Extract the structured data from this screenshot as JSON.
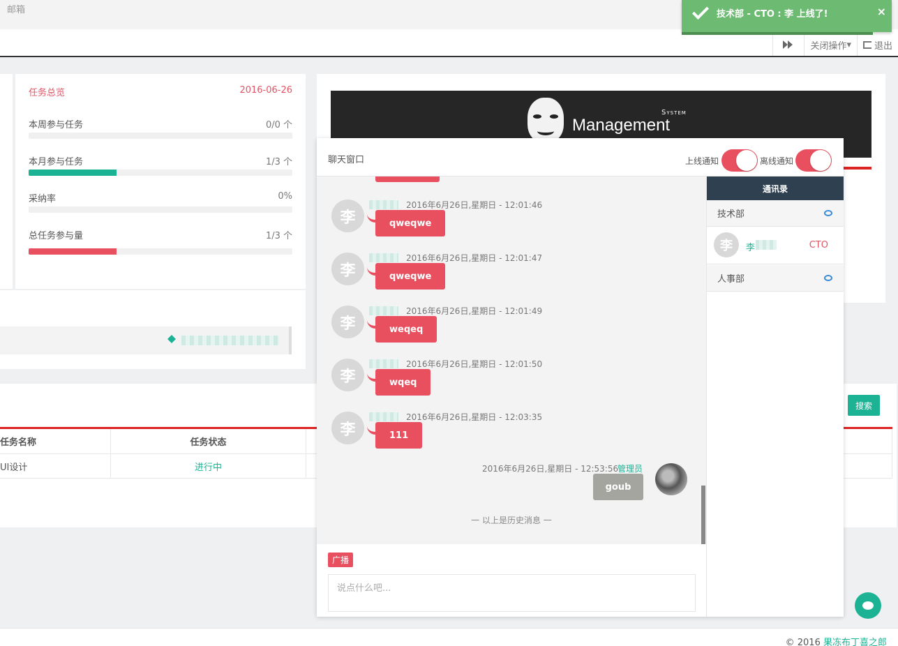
{
  "topbar": {
    "mail": "邮箱"
  },
  "subbar": {
    "close_ops": "关闭操作",
    "logout": "退出"
  },
  "task": {
    "title": "任务总览",
    "date": "2016-06-26",
    "rows": [
      {
        "label": "本周参与任务",
        "value": "0/0 个",
        "progress": 0
      },
      {
        "label": "本月参与任务",
        "value": "1/3 个",
        "progress": 0.333,
        "color": "#1bb394"
      },
      {
        "label": "采纳率",
        "value": "0%",
        "progress": 0
      },
      {
        "label": "总任务参与量",
        "value": "1/3 个",
        "progress": 0.333,
        "color": "#e9505f"
      }
    ]
  },
  "banner": {
    "system": "System",
    "brand": "Management"
  },
  "table": {
    "search": "搜索",
    "headers": [
      "任务名称",
      "任务状态"
    ],
    "rows": [
      {
        "name": "UI设计",
        "status": "进行中"
      }
    ]
  },
  "footer": {
    "copy": "© 2016 ",
    "link": "果冻布丁喜之郎"
  },
  "chat": {
    "title": "聊天窗口",
    "online_label": "上线通知",
    "offline_label": "离线通知",
    "avatar_char": "李",
    "messages": [
      {
        "time": "2016年6月26日,星期日 - 12:01:46",
        "text": "qweqwe"
      },
      {
        "time": "2016年6月26日,星期日 - 12:01:47",
        "text": "qweqwe"
      },
      {
        "time": "2016年6月26日,星期日 - 12:01:49",
        "text": "weqeq"
      },
      {
        "time": "2016年6月26日,星期日 - 12:01:50",
        "text": "wqeq"
      },
      {
        "time": "2016年6月26日,星期日 - 12:03:35",
        "text": "111"
      }
    ],
    "mine": {
      "time": "2016年6月26日,星期日 - 12:53:56",
      "role": "管理员",
      "text": "goub"
    },
    "history": "一  以上是历史消息  一",
    "broadcast": "广播",
    "input_placeholder": "说点什么吧..."
  },
  "contacts": {
    "title": "通讯录",
    "dept1": "技术部",
    "member": {
      "avatar": "李",
      "name": "李",
      "title": "CTO"
    },
    "dept2": "人事部"
  },
  "toast": {
    "text": "技术部 - CTO : 李      上线了!",
    "close": "×"
  },
  "colors": {
    "accent": "#1bb394",
    "red": "#e9505f",
    "dark": "#2f4050"
  }
}
